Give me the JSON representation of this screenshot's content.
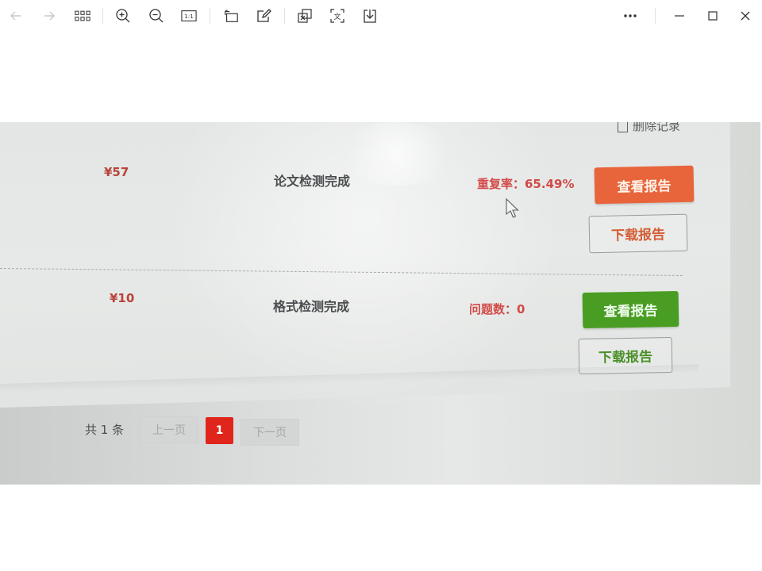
{
  "toolbar": {
    "icons": [
      "back-arrow-icon",
      "forward-arrow-icon",
      "grid-icon",
      "zoom-in-icon",
      "zoom-out-icon",
      "actual-size-icon",
      "rotate-icon",
      "edit-icon",
      "crop-icon",
      "ocr-text-icon",
      "save-download-icon",
      "more-icon",
      "minimize-icon",
      "maximize-icon",
      "close-icon"
    ],
    "actual_size_label": "1:1",
    "ocr_label": "文"
  },
  "photo": {
    "delete_record_label": "删除记录",
    "orders": [
      {
        "price": "¥57",
        "status": "论文检测完成",
        "metric": "重复率：65.49%",
        "view_button": "查看报告",
        "download_button": "下载报告",
        "accent_color": "#e8653c"
      },
      {
        "price": "¥10",
        "status": "格式检测完成",
        "metric": "问题数：0",
        "view_button": "查看报告",
        "download_button": "下载报告",
        "accent_color": "#4a9d23"
      }
    ],
    "pagination": {
      "total_prefix": "共",
      "total_count": "1",
      "total_suffix": "条",
      "prev_label": "上一页",
      "current_page": "1",
      "next_label": "下一页"
    }
  }
}
